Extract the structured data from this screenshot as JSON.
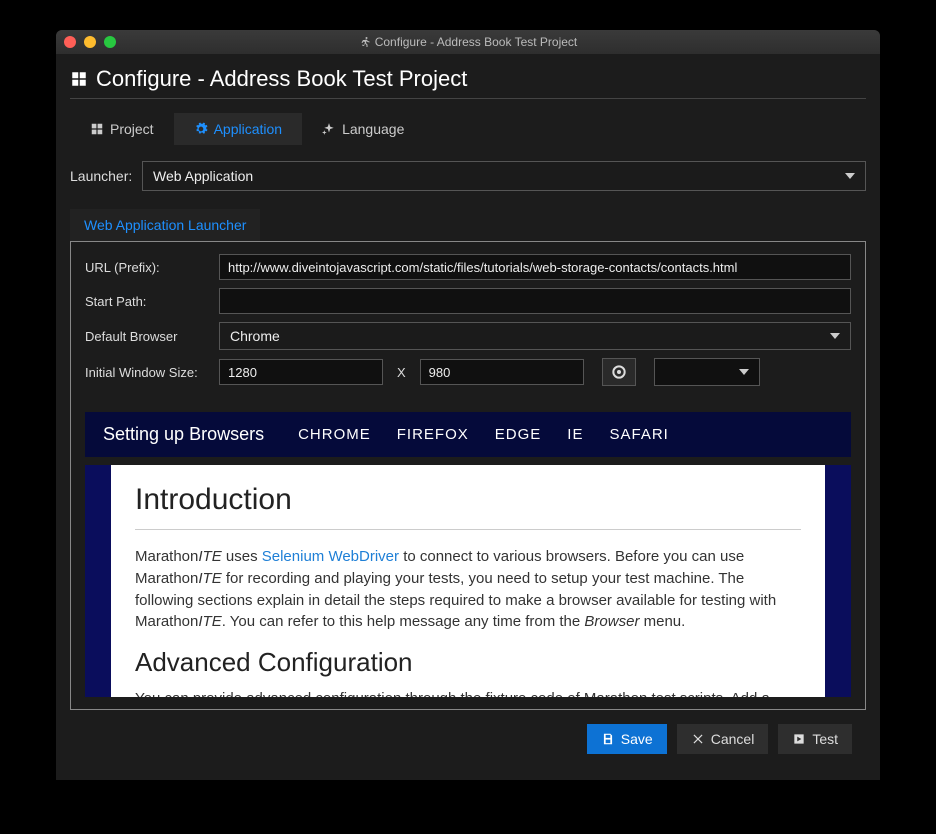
{
  "window_title": "Configure - Address Book Test Project",
  "page_title": "Configure - Address Book Test Project",
  "tabs": {
    "project": "Project",
    "application": "Application",
    "language": "Language"
  },
  "launcher": {
    "label": "Launcher:",
    "value": "Web Application"
  },
  "subtab": "Web Application Launcher",
  "form": {
    "url_label": "URL (Prefix):",
    "url_value": "http://www.diveintojavascript.com/static/files/tutorials/web-storage-contacts/contacts.html",
    "startpath_label": "Start Path:",
    "startpath_value": "",
    "browser_label": "Default Browser",
    "browser_value": "Chrome",
    "winsize_label": "Initial Window Size:",
    "width": "1280",
    "height": "980",
    "sep": "X"
  },
  "browsers": {
    "title": "Setting up Browsers",
    "items": [
      "CHROME",
      "FIREFOX",
      "EDGE",
      "IE",
      "SAFARI"
    ]
  },
  "doc": {
    "h1": "Introduction",
    "p1a": "Marathon",
    "p1b": "ITE",
    "p1c": " uses ",
    "p1link": "Selenium WebDriver",
    "p1d": " to connect to various browsers. Before you can use Marathon",
    "p1e": "ITE",
    "p1f": " for recording and playing your tests, you need to setup your test machine. The following sections explain in detail the steps required to make a browser available for testing with Marathon",
    "p1g": "ITE",
    "p1h": ". You can refer to this help message any time from the ",
    "p1i": "Browser",
    "p1j": " menu.",
    "h2": "Advanced Configuration",
    "p2": "You can provide advanced configuration through the fixture code of Marathon test scripts. Add a"
  },
  "buttons": {
    "save": "Save",
    "cancel": "Cancel",
    "test": "Test"
  }
}
